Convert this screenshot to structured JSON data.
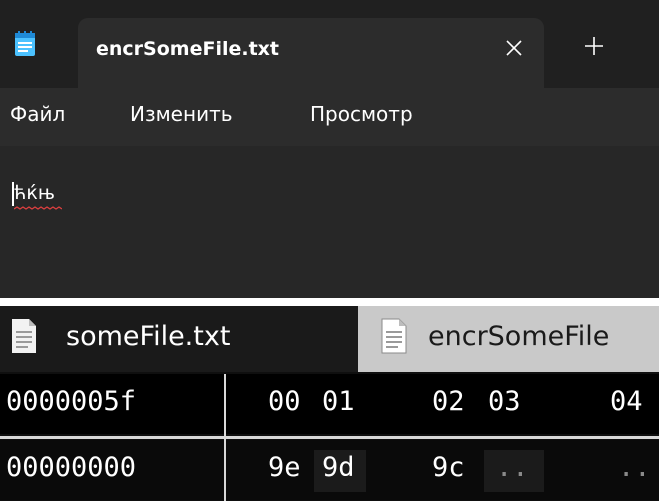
{
  "notepad": {
    "tab_title": "encrSomeFile.txt",
    "close_glyph": "✕",
    "new_tab_glyph": "+",
    "menu": [
      "Файл",
      "Изменить",
      "Просмотр"
    ],
    "content": "ћќњ",
    "app_icon": "notepad-icon",
    "accent_color": "#4cc2ff"
  },
  "hex_editor": {
    "tabs": [
      {
        "title": "someFile.txt",
        "active": false,
        "icon": "file-icon"
      },
      {
        "title": "encrSomeFile",
        "active": true,
        "icon": "file-icon"
      }
    ],
    "header_offset": "0000005f",
    "columns": [
      "00",
      "01",
      "02",
      "03",
      "04"
    ],
    "rows": [
      {
        "offset": "00000000",
        "bytes": [
          "9e",
          "9d",
          "9c",
          "..",
          ".."
        ]
      }
    ]
  }
}
